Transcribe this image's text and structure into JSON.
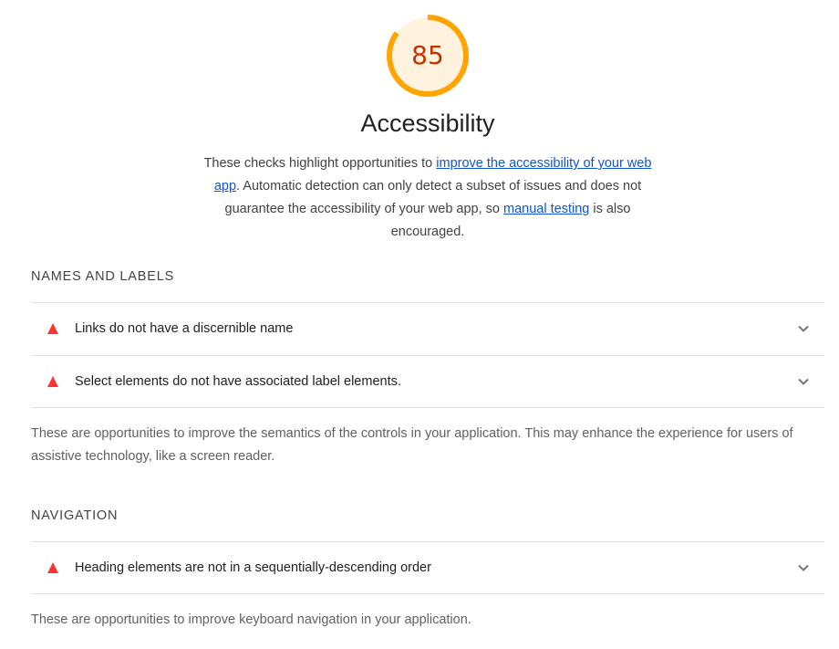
{
  "score": {
    "value": "85",
    "fraction": 0.85,
    "color": "#ffa400"
  },
  "category": {
    "title": "Accessibility",
    "description_parts": {
      "t1": "These checks highlight opportunities to ",
      "link1": "improve the accessibility of your web app",
      "t2": ". Automatic detection can only detect a subset of issues and does not guarantee the accessibility of your web app, so ",
      "link2": "manual testing",
      "t3": " is also encouraged."
    }
  },
  "groups": [
    {
      "title": "NAMES AND LABELS",
      "audits": [
        {
          "label": "Links do not have a discernible name"
        },
        {
          "label": "Select elements do not have associated label elements."
        }
      ],
      "description": "These are opportunities to improve the semantics of the controls in your application. This may enhance the experience for users of assistive technology, like a screen reader."
    },
    {
      "title": "NAVIGATION",
      "audits": [
        {
          "label": "Heading elements are not in a sequentially-descending order"
        }
      ],
      "description": "These are opportunities to improve keyboard navigation in your application."
    }
  ]
}
